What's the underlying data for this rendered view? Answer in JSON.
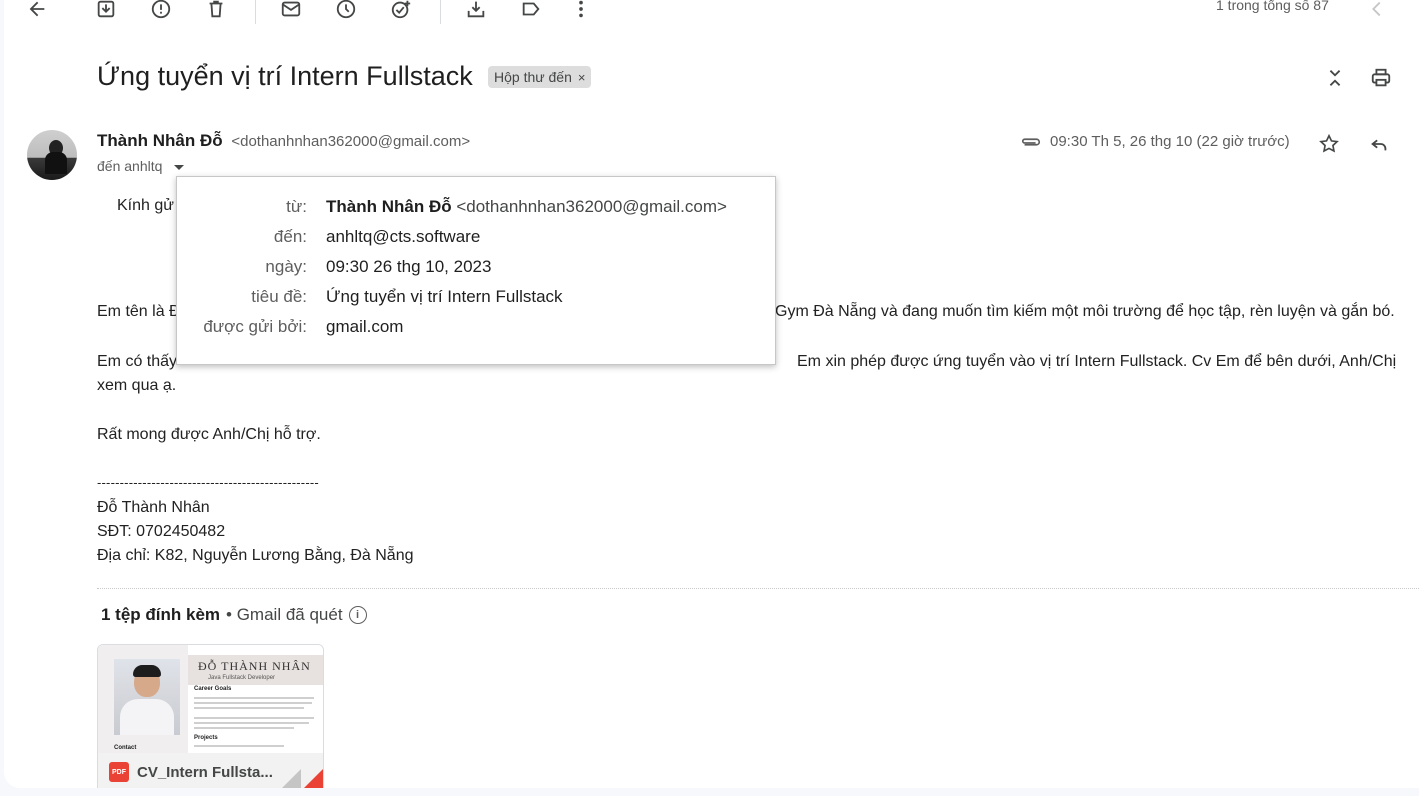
{
  "toolbar": {
    "counter": "1 trong tổng số 87"
  },
  "email": {
    "subject": "Ứng tuyển vị trí Intern Fullstack",
    "label": "Hộp thư đến",
    "label_remove": "×",
    "sender_name": "Thành Nhân Đỗ",
    "sender_email": "<dothanhnhan362000@gmail.com>",
    "to_summary": "đến anhltq",
    "timestamp": "09:30 Th 5, 26 thg 10 (22 giờ trước)"
  },
  "details_popup": {
    "rows": [
      {
        "key": "từ:",
        "name": "Thành Nhân Đỗ",
        "value": "<dothanhnhan362000@gmail.com>"
      },
      {
        "key": "đến:",
        "value": "anhltq@cts.software"
      },
      {
        "key": "ngày:",
        "value": "09:30 26 thg 10, 2023"
      },
      {
        "key": "tiêu đề:",
        "value": "Ứng tuyển vị trí Intern Fullstack"
      },
      {
        "key": "được gửi bởi:",
        "value": "gmail.com"
      }
    ]
  },
  "body": {
    "greeting_visible": "Kính gử",
    "line_intro_start": "Em tên là Đ",
    "line_intro_end": "Gym Đà Nẵng và đang muốn tìm kiếm một môi trường để học tập, rèn luyện và gắn bó.",
    "line_apply_start": "Em có thấy",
    "line_apply_end": "Em xin phép được ứng tuyển vào vị trí Intern Fullstack. Cv Em để bên dưới,  Anh/Chị",
    "line_apply_2": "xem qua ạ.",
    "line_support": "Rất mong được Anh/Chị hỗ trợ.",
    "signature_rule": "-------------------------------------------------",
    "signature_name": "Đỗ Thành Nhân",
    "signature_phone": "SĐT: 0702450482",
    "signature_address": "Địa chỉ: K82, Nguyễn Lương Bằng, Đà Nẵng"
  },
  "attachments": {
    "count_label": "1 tệp đính kèm",
    "scan_label": "• Gmail đã quét",
    "file_name": "CV_Intern Fullsta...",
    "file_type": "PDF",
    "thumb_name": "ĐỖ THÀNH NHÂN",
    "thumb_role": "Java Fullstack Developer",
    "thumb_heading_goals": "Career Goals",
    "thumb_heading_projects": "Projects",
    "thumb_heading_contact": "Contact"
  },
  "colors": {
    "accent_red": "#ea4335",
    "chip_bg": "#dddddd",
    "text_primary": "#1f1f1f",
    "text_secondary": "#5e5e5e"
  }
}
